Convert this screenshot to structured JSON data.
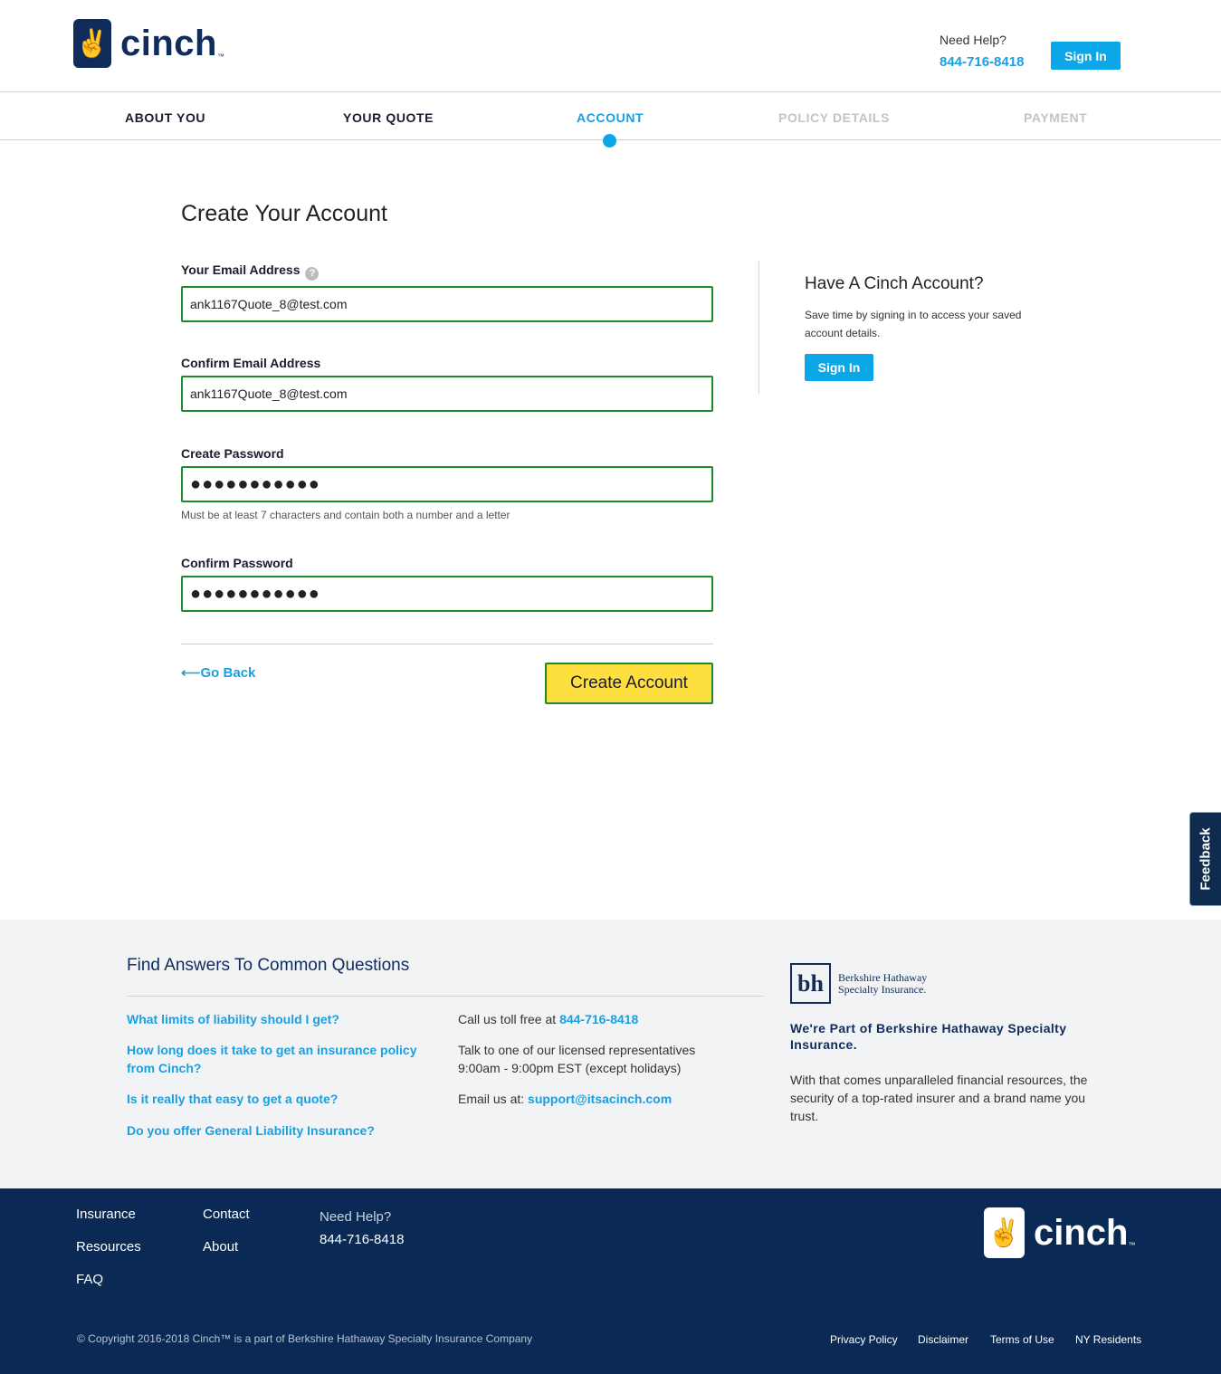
{
  "header": {
    "logo_text": "cinch",
    "logo_tm": "™",
    "help_label": "Need Help?",
    "help_phone": "844-716-8418",
    "signin_label": "Sign In"
  },
  "steps": [
    {
      "label": "ABOUT YOU",
      "state": "done"
    },
    {
      "label": "YOUR QUOTE",
      "state": "done"
    },
    {
      "label": "ACCOUNT",
      "state": "active"
    },
    {
      "label": "POLICY DETAILS",
      "state": "pending"
    },
    {
      "label": "PAYMENT",
      "state": "pending"
    }
  ],
  "form": {
    "title": "Create Your Account",
    "email_label": "Your Email Address",
    "email_value": "ank1167Quote_8@test.com",
    "confirm_email_label": "Confirm Email Address",
    "confirm_email_value": "ank1167Quote_8@test.com",
    "password_label": "Create Password",
    "password_value": "●●●●●●●●●●●",
    "password_hint": "Must be at least 7 characters and contain both a number and a letter",
    "confirm_password_label": "Confirm Password",
    "confirm_password_value": "●●●●●●●●●●●",
    "go_back_label": "Go Back",
    "create_label": "Create Account"
  },
  "side": {
    "title": "Have A Cinch Account?",
    "text": "Save time by signing in to access your saved account details.",
    "signin_label": "Sign In"
  },
  "feedback_label": "Feedback",
  "faq": {
    "title": "Find Answers To Common Questions",
    "questions": [
      "What limits of liability should I get?",
      "How long does it take to get an insurance policy from Cinch?",
      "Is it really that easy to get a quote?",
      "Do you offer General Liability Insurance?"
    ],
    "call_prefix": "Call us toll free at",
    "call_phone": "844-716-8418",
    "talk_text": "Talk to one of our licensed representatives 9:00am - 9:00pm EST (except holidays)",
    "email_prefix": "Email us at:",
    "email_address": "support@itsacinch.com",
    "bh_mark": "bh",
    "bh_name_line1": "Berkshire Hathaway",
    "bh_name_line2": "Specialty Insurance.",
    "bh_heading": "We're Part of Berkshire Hathaway Specialty Insurance.",
    "bh_body": "With that comes unparalleled financial resources, the security of a top-rated insurer and a brand name you trust."
  },
  "footer": {
    "links_col1": [
      "Insurance",
      "Resources",
      "FAQ"
    ],
    "links_col2": [
      "Contact",
      "About"
    ],
    "help_label": "Need Help?",
    "help_phone": "844-716-8418",
    "logo_text": "cinch",
    "logo_tm": "™",
    "copyright": "© Copyright 2016-2018 Cinch™ is a part of Berkshire Hathaway Specialty Insurance Company",
    "legal_links": [
      "Privacy Policy",
      "Disclaimer",
      "Terms of Use",
      "NY Residents"
    ]
  },
  "colors": {
    "accent_blue": "#0ba7e8",
    "navy": "#0a2a55",
    "valid_green": "#1e8a2e",
    "cta_yellow": "#fde03f"
  },
  "icons": {
    "logo": "cinch-hand-icon",
    "help": "question-circle-icon",
    "back": "arrow-left-icon"
  }
}
